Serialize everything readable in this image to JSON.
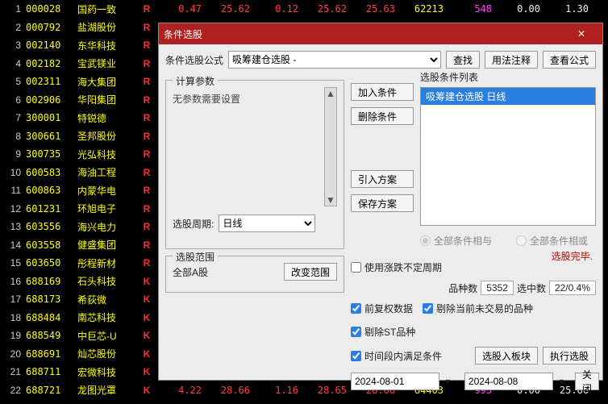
{
  "rows": [
    {
      "i": 1,
      "code": "000028",
      "name": "国药一致",
      "flag": "R",
      "v": [
        "0.47",
        "25.62",
        "0.12",
        "25.62",
        "25.63",
        "62213",
        "548",
        "0.00",
        "1.30"
      ],
      "cls": [
        "red",
        "red",
        "red",
        "red",
        "red",
        "yellow",
        "magenta",
        "white",
        "white"
      ]
    },
    {
      "i": 2,
      "code": "000792",
      "name": "盐湖股份",
      "flag": "R"
    },
    {
      "i": 3,
      "code": "002140",
      "name": "东华科技",
      "flag": "R"
    },
    {
      "i": 4,
      "code": "002182",
      "name": "宝武镁业",
      "flag": "R"
    },
    {
      "i": 5,
      "code": "002311",
      "name": "海大集团",
      "flag": "R"
    },
    {
      "i": 6,
      "code": "002906",
      "name": "华阳集团",
      "flag": "R"
    },
    {
      "i": 7,
      "code": "300001",
      "name": "特锐德",
      "flag": "R"
    },
    {
      "i": 8,
      "code": "300661",
      "name": "圣邦股份",
      "flag": "R"
    },
    {
      "i": 9,
      "code": "300735",
      "name": "光弘科技",
      "flag": "R"
    },
    {
      "i": 10,
      "code": "600583",
      "name": "海油工程",
      "flag": "R"
    },
    {
      "i": 11,
      "code": "600863",
      "name": "内蒙华电",
      "flag": "R"
    },
    {
      "i": 12,
      "code": "601231",
      "name": "环旭电子",
      "flag": "R"
    },
    {
      "i": 13,
      "code": "603556",
      "name": "海兴电力",
      "flag": "R"
    },
    {
      "i": 14,
      "code": "603558",
      "name": "健盛集团",
      "flag": "R"
    },
    {
      "i": 15,
      "code": "603650",
      "name": "彤程新材",
      "flag": "R"
    },
    {
      "i": 16,
      "code": "688169",
      "name": "石头科技",
      "flag": "K"
    },
    {
      "i": 17,
      "code": "688173",
      "name": "希荻微",
      "flag": "K"
    },
    {
      "i": 18,
      "code": "688484",
      "name": "南芯科技",
      "flag": "K"
    },
    {
      "i": 19,
      "code": "688549",
      "name": "中巨芯-U",
      "flag": "K"
    },
    {
      "i": 20,
      "code": "688691",
      "name": "灿芯股份",
      "flag": "K"
    },
    {
      "i": 21,
      "code": "688711",
      "name": "宏微科技",
      "flag": "K"
    },
    {
      "i": 22,
      "code": "688721",
      "name": "龙图光罩",
      "flag": "K",
      "v": [
        "4.22",
        "28.66",
        "1.16",
        "28.65",
        "28.66",
        "64403",
        "993",
        "0.00",
        "25.66"
      ],
      "cls": [
        "red",
        "red",
        "red",
        "red",
        "red",
        "yellow",
        "magenta",
        "white",
        "white"
      ]
    }
  ],
  "dialog": {
    "title": "条件选股",
    "formula_label": "条件选股公式",
    "formula_value": "吸筹建仓选股 -",
    "btn_find": "查找",
    "btn_usage": "用法注释",
    "btn_view": "查看公式",
    "params_legend": "计算参数",
    "params_text": "无参数需要设置",
    "period_label": "选股周期:",
    "period_value": "日线",
    "btn_add": "加入条件",
    "btn_del": "删除条件",
    "btn_import": "引入方案",
    "btn_save": "保存方案",
    "list_label": "选股条件列表",
    "list_item": "吸筹建仓选股 日线",
    "radio_and": "全部条件相与",
    "radio_or": "全部条件相或",
    "done": "选股完毕.",
    "scope_legend": "选股范围",
    "scope_value": "全部A股",
    "btn_change": "改变范围",
    "ck_indef": "使用涨跌不定周期",
    "count_label": "品种数",
    "count_value": "5352",
    "hit_label": "选中数",
    "hit_value": "22/0.4%",
    "ck_fq": "前复权数据",
    "ck_notrade": "剔除当前未交易的品种",
    "ck_st": "剔除ST品种",
    "ck_range": "时间段内满足条件",
    "btn_toblock": "选股入板块",
    "btn_run": "执行选股",
    "date_from": "2024-08-01",
    "date_sep": "-",
    "date_to": "2024-08-08",
    "btn_close": "关闭"
  }
}
